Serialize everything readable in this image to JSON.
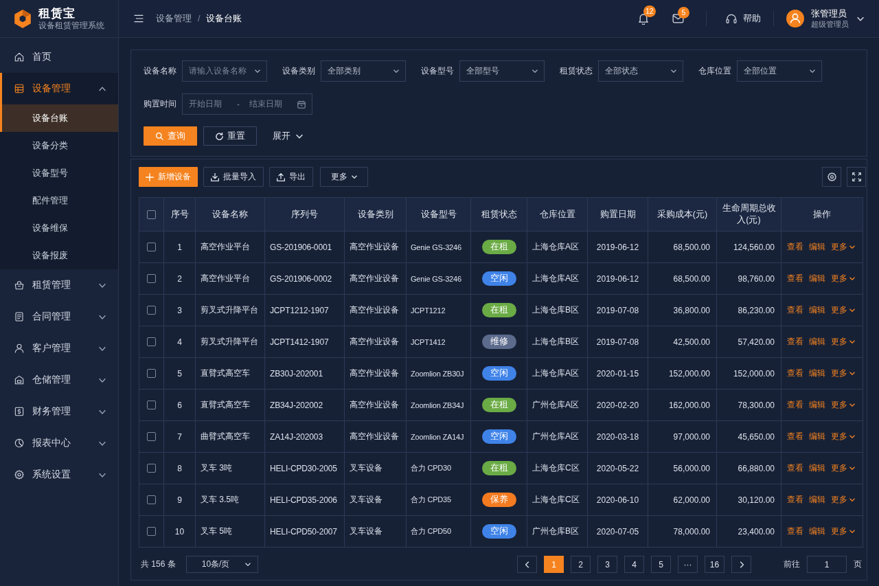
{
  "sidebar": {
    "brand": {
      "title": "租赁宝",
      "subtitle": "设备租赁管理系统"
    },
    "items": [
      {
        "label": "首页",
        "selected": false
      },
      {
        "label": "设备管理",
        "selected": true,
        "expanded": true,
        "children": [
          {
            "label": "设备台账",
            "selected": true
          },
          {
            "label": "设备分类",
            "selected": false
          },
          {
            "label": "设备型号",
            "selected": false
          },
          {
            "label": "配件管理",
            "selected": false
          },
          {
            "label": "设备维保",
            "selected": false
          },
          {
            "label": "设备报废",
            "selected": false
          }
        ]
      },
      {
        "label": "租赁管理",
        "selected": false,
        "expanded": false
      },
      {
        "label": "合同管理",
        "selected": false,
        "expanded": false
      },
      {
        "label": "客户管理",
        "selected": false,
        "expanded": false
      },
      {
        "label": "仓储管理",
        "selected": false,
        "expanded": false
      },
      {
        "label": "财务管理",
        "selected": false,
        "expanded": false
      },
      {
        "label": "报表中心",
        "selected": false,
        "expanded": false
      },
      {
        "label": "系统设置",
        "selected": false,
        "expanded": false
      }
    ]
  },
  "header": {
    "breadcrumb": [
      "设备管理",
      "设备台账"
    ],
    "breadcrumb_separator": "/",
    "notifications": "12",
    "messages": "5",
    "help": "帮助",
    "user": {
      "name": "张管理员",
      "role": "超级管理员"
    }
  },
  "filters": {
    "fields": [
      {
        "label": "设备名称",
        "placeholder": "请输入设备名称"
      },
      {
        "label": "设备类别",
        "value": "全部类别"
      },
      {
        "label": "设备型号",
        "value": "全部型号"
      },
      {
        "label": "租赁状态",
        "value": "全部状态"
      },
      {
        "label": "仓库位置",
        "value": "全部位置"
      }
    ],
    "date_range": {
      "label": "购置时间",
      "start_placeholder": "开始日期",
      "separator": "-",
      "end_placeholder": "结束日期"
    },
    "buttons": [
      {
        "label": "查询",
        "kind": "primary"
      },
      {
        "label": "重置",
        "kind": "default"
      },
      {
        "label": "展开",
        "kind": "text"
      }
    ]
  },
  "toolbar": {
    "buttons": [
      {
        "label": "新增设备",
        "kind": "primary"
      },
      {
        "label": "批量导入",
        "kind": "default"
      },
      {
        "label": "导出",
        "kind": "default"
      },
      {
        "label": "更多",
        "kind": "dropdown"
      }
    ]
  },
  "table": {
    "select_all": {
      "checked": false
    },
    "columns": [
      "序号",
      "设备名称",
      "序列号",
      "设备类别",
      "设备型号",
      "租赁状态",
      "仓库位置",
      "购置日期",
      "采购成本(元)",
      "生命周期总收入(元)",
      "操作"
    ],
    "rows": [
      {
        "selected": false,
        "index": "1",
        "name": "高空作业平台",
        "serial": "GS-201906-0001",
        "category": "高空作业设备",
        "model": "Genie GS-3246",
        "status": {
          "label": "在租",
          "color": "#6aab45"
        },
        "location": "上海仓库A区",
        "purchase_date": "2019-06-12",
        "cost": "68,500.00",
        "revenue": "124,560.00",
        "actions": [
          "查看",
          "编辑",
          "更多"
        ]
      },
      {
        "selected": false,
        "index": "2",
        "name": "高空作业平台",
        "serial": "GS-201906-0002",
        "category": "高空作业设备",
        "model": "Genie GS-3246",
        "status": {
          "label": "空闲",
          "color": "#3f83e8"
        },
        "location": "上海仓库A区",
        "purchase_date": "2019-06-12",
        "cost": "68,500.00",
        "revenue": "98,760.00",
        "actions": [
          "查看",
          "编辑",
          "更多"
        ]
      },
      {
        "selected": false,
        "index": "3",
        "name": "剪叉式升降平台",
        "serial": "JCPT1212-1907",
        "category": "高空作业设备",
        "model": "JCPT1212",
        "status": {
          "label": "在租",
          "color": "#6aab45"
        },
        "location": "上海仓库B区",
        "purchase_date": "2019-07-08",
        "cost": "36,800.00",
        "revenue": "86,230.00",
        "actions": [
          "查看",
          "编辑",
          "更多"
        ]
      },
      {
        "selected": false,
        "index": "4",
        "name": "剪叉式升降平台",
        "serial": "JCPT1412-1907",
        "category": "高空作业设备",
        "model": "JCPT1412",
        "status": {
          "label": "维修",
          "color": "#5c6a8c"
        },
        "location": "上海仓库B区",
        "purchase_date": "2019-07-08",
        "cost": "42,500.00",
        "revenue": "57,420.00",
        "actions": [
          "查看",
          "编辑",
          "更多"
        ]
      },
      {
        "selected": false,
        "index": "5",
        "name": "直臂式高空车",
        "serial": "ZB30J-202001",
        "category": "高空作业设备",
        "model": "Zoomlion ZB30J",
        "status": {
          "label": "空闲",
          "color": "#3f83e8"
        },
        "location": "上海仓库A区",
        "purchase_date": "2020-01-15",
        "cost": "152,000.00",
        "revenue": "152,000.00",
        "actions": [
          "查看",
          "编辑",
          "更多"
        ]
      },
      {
        "selected": false,
        "index": "6",
        "name": "直臂式高空车",
        "serial": "ZB34J-202002",
        "category": "高空作业设备",
        "model": "Zoomlion ZB34J",
        "status": {
          "label": "在租",
          "color": "#6aab45"
        },
        "location": "广州仓库A区",
        "purchase_date": "2020-02-20",
        "cost": "162,000.00",
        "revenue": "78,300.00",
        "actions": [
          "查看",
          "编辑",
          "更多"
        ]
      },
      {
        "selected": false,
        "index": "7",
        "name": "曲臂式高空车",
        "serial": "ZA14J-202003",
        "category": "高空作业设备",
        "model": "Zoomlion ZA14J",
        "status": {
          "label": "空闲",
          "color": "#3f83e8"
        },
        "location": "广州仓库A区",
        "purchase_date": "2020-03-18",
        "cost": "97,000.00",
        "revenue": "45,650.00",
        "actions": [
          "查看",
          "编辑",
          "更多"
        ]
      },
      {
        "selected": false,
        "index": "8",
        "name": "叉车 3吨",
        "serial": "HELI-CPD30-2005",
        "category": "叉车设备",
        "model": "合力 CPD30",
        "status": {
          "label": "在租",
          "color": "#6aab45"
        },
        "location": "上海仓库C区",
        "purchase_date": "2020-05-22",
        "cost": "56,000.00",
        "revenue": "66,880.00",
        "actions": [
          "查看",
          "编辑",
          "更多"
        ]
      },
      {
        "selected": false,
        "index": "9",
        "name": "叉车 3.5吨",
        "serial": "HELI-CPD35-2006",
        "category": "叉车设备",
        "model": "合力 CPD35",
        "status": {
          "label": "保养",
          "color": "#f47b20"
        },
        "location": "上海仓库C区",
        "purchase_date": "2020-06-10",
        "cost": "62,000.00",
        "revenue": "30,120.00",
        "actions": [
          "查看",
          "编辑",
          "更多"
        ]
      },
      {
        "selected": false,
        "index": "10",
        "name": "叉车 5吨",
        "serial": "HELI-CPD50-2007",
        "category": "叉车设备",
        "model": "合力 CPD50",
        "status": {
          "label": "空闲",
          "color": "#3f83e8"
        },
        "location": "广州仓库B区",
        "purchase_date": "2020-07-05",
        "cost": "78,000.00",
        "revenue": "23,400.00",
        "actions": [
          "查看",
          "编辑",
          "更多"
        ]
      }
    ]
  },
  "pagination": {
    "total": "共 156 条",
    "page_size": "10条/页",
    "pages": [
      {
        "label": "1",
        "selected": true
      },
      {
        "label": "2",
        "selected": false
      },
      {
        "label": "3",
        "selected": false
      },
      {
        "label": "4",
        "selected": false
      },
      {
        "label": "5",
        "selected": false
      },
      {
        "label": "···",
        "selected": false
      },
      {
        "label": "16",
        "selected": false
      }
    ],
    "goto_label": "前往",
    "goto_value": "1",
    "goto_unit": "页"
  }
}
